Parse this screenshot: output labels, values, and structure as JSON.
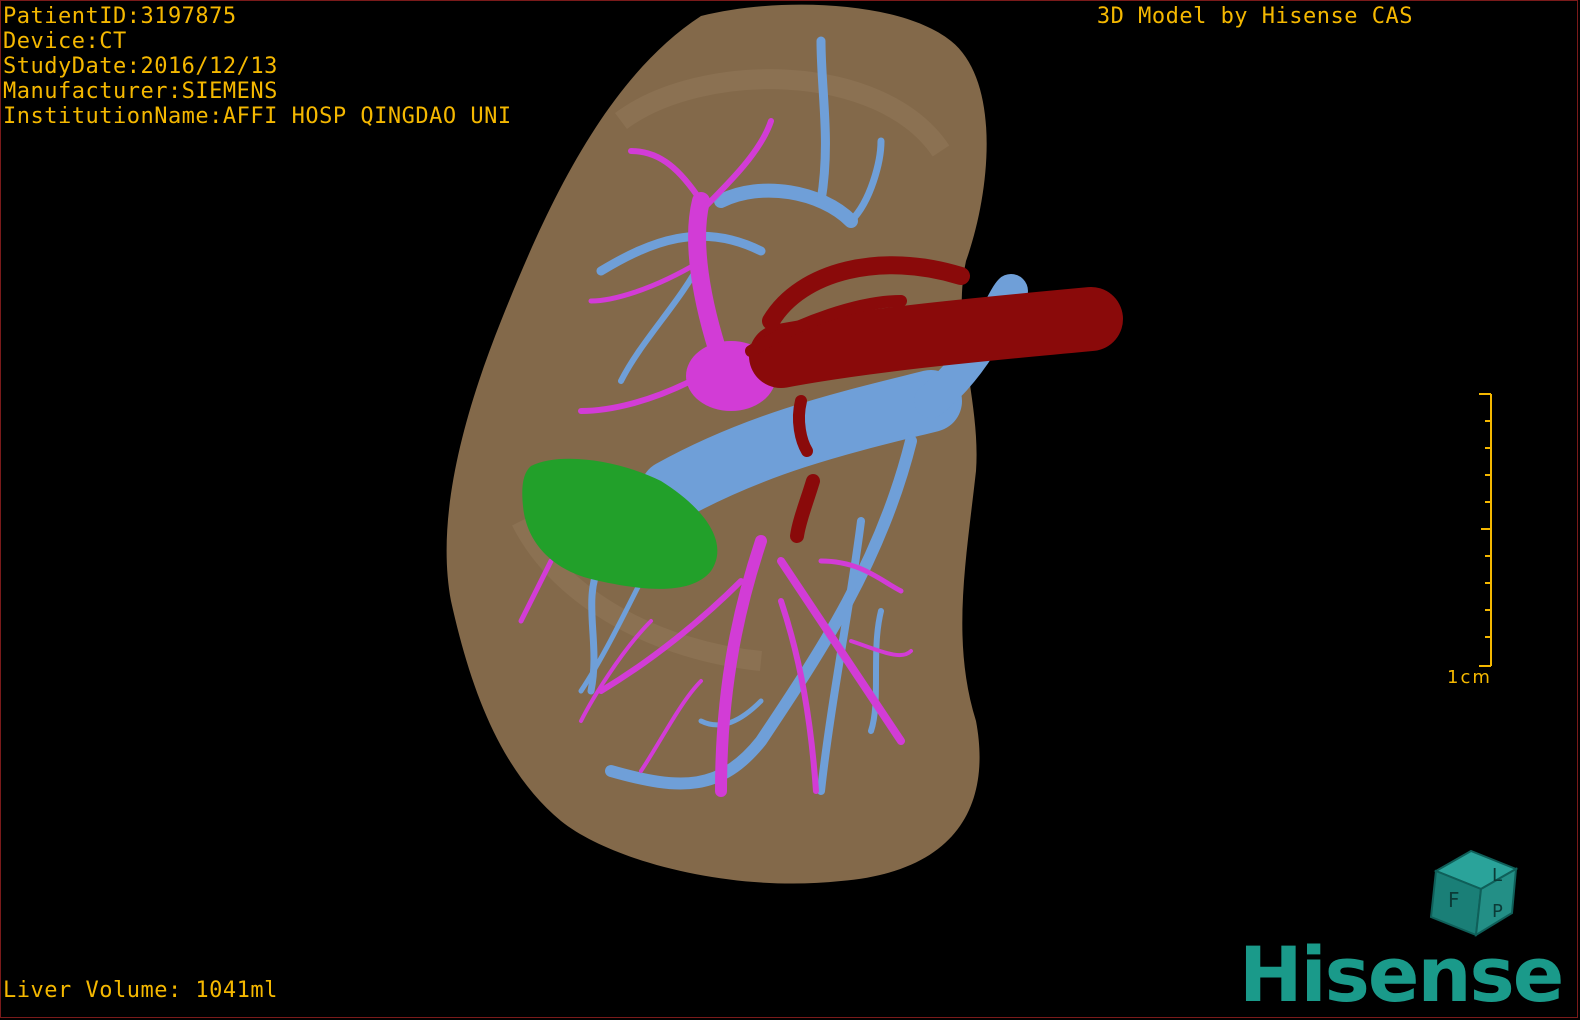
{
  "patient_info": {
    "patient_id": "PatientID:3197875",
    "device": "Device:CT",
    "study_date": "StudyDate:2016/12/13",
    "manufacturer": "Manufacturer:SIEMENS",
    "institution": "InstitutionName:AFFI HOSP QINGDAO UNI"
  },
  "brand_caption": "3D Model by Hisense CAS",
  "liver_volume": "Liver Volume: 1041ml",
  "scale": {
    "label": "1cm"
  },
  "orientation_cube": {
    "labels": [
      "F",
      "L",
      "P"
    ]
  },
  "logo_text": "Hisense",
  "colors": {
    "overlay_text": "#f5b800",
    "liver": "#8a6f4e",
    "portal_vein": "#6f9fd8",
    "hepatic_vein": "#d23cd6",
    "artery": "#8a0a0a",
    "lesion": "#22a02a",
    "logo": "#1a9a8a"
  }
}
